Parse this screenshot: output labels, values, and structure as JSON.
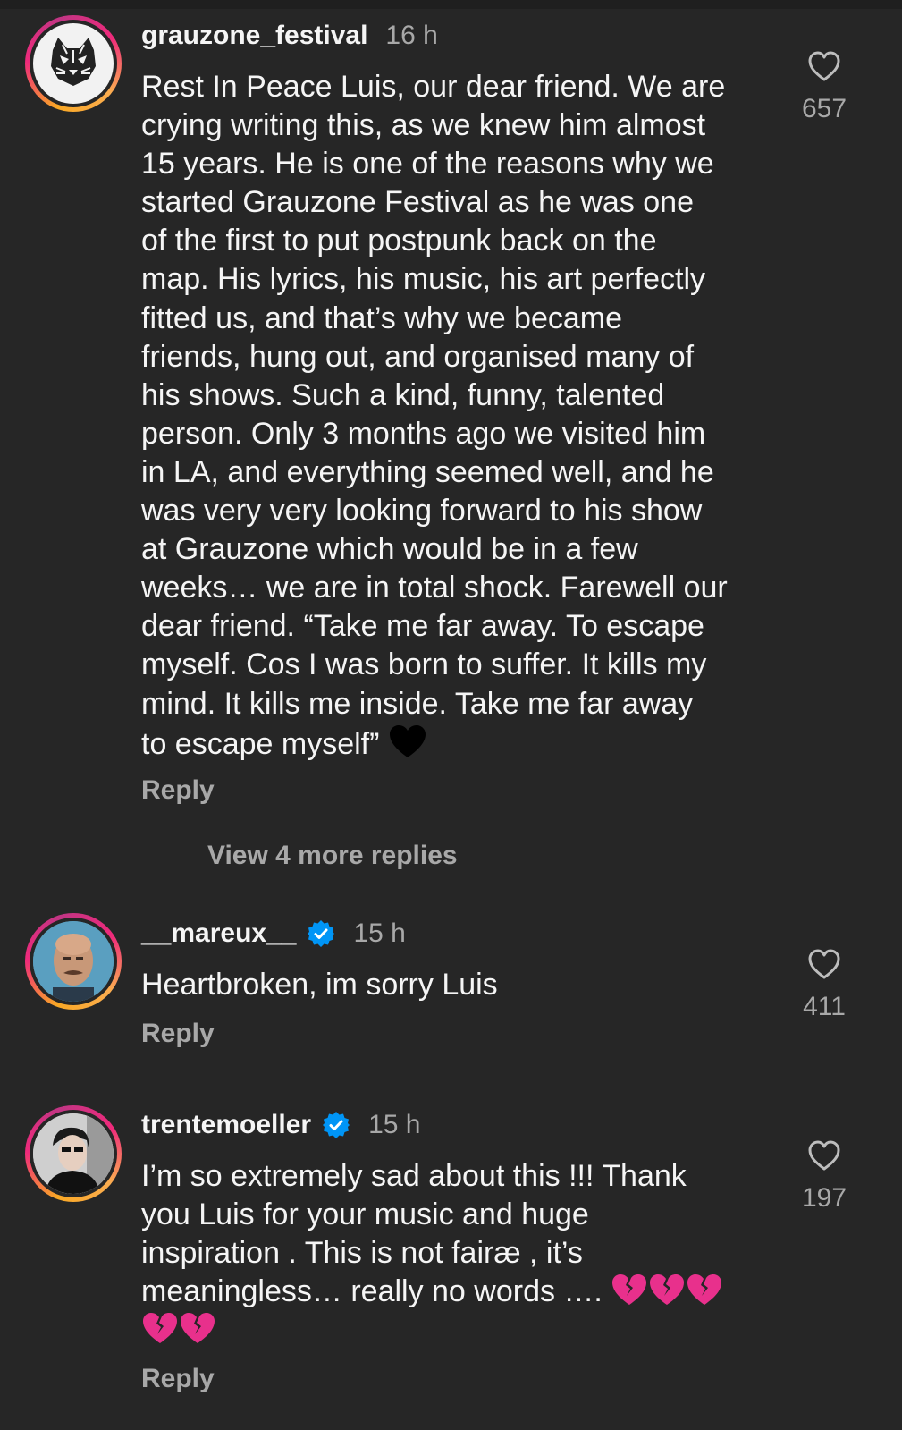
{
  "comments": [
    {
      "username": "grauzone_festival",
      "verified": false,
      "time": "16 h",
      "text": "Rest In Peace Luis, our dear friend. We are\ncrying writing this, as we knew him almost\n15 years. He is one of the reasons why we\nstarted Grauzone Festival as he was one\nof the first to put postpunk back on the\nmap. His lyrics, his music, his art perfectly\nfitted us, and that’s why we became\nfriends, hung out, and organised many of\nhis shows. Such a kind, funny, talented\nperson. Only 3 months ago we visited him\nin LA, and everything seemed well, and he\nwas very very looking forward to his show\nat Grauzone which would be in a few\nweeks… we are in total shock. Farewell our\ndear friend. “Take me far away. To escape\nmyself. Cos I was born to suffer. It kills my\nmind. It kills me inside. Take me far away\nto escape myself”",
      "trailing_emoji": "black-heart",
      "likes": "657",
      "reply_label": "Reply",
      "view_more_label": "View 4 more replies"
    },
    {
      "username": "__mareux__",
      "verified": true,
      "time": "15 h",
      "text": "Heartbroken, im sorry Luis",
      "likes": "411",
      "reply_label": "Reply"
    },
    {
      "username": "trentemoeller",
      "verified": true,
      "time": "15 h",
      "text": "I’m so extremely sad about this !!! Thank\nyou Luis for your music and huge\ninspiration . This is not fairæ , it’s\nmeaningless… really no words ….",
      "trailing_emoji": "broken-heart x5",
      "likes": "197",
      "reply_label": "Reply"
    }
  ],
  "colors": {
    "background": "#262626",
    "primary_text": "#f5f5f5",
    "secondary_text": "#a8a8a8",
    "verified_badge": "#0095f6",
    "broken_heart": "#e8308c"
  }
}
